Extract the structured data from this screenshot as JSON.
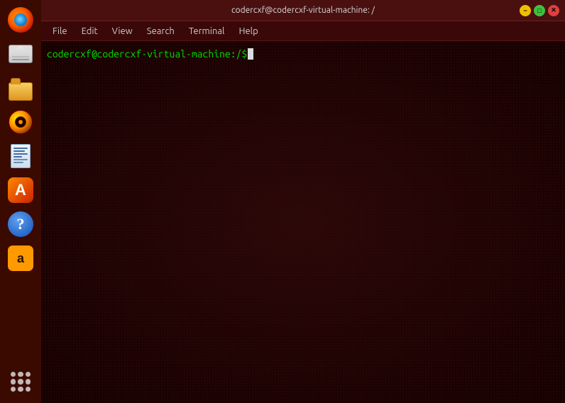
{
  "window": {
    "title": "codercxf@codercxf-virtual-machine: /",
    "controls": {
      "minimize": "−",
      "maximize": "□",
      "close": "✕"
    }
  },
  "menubar": {
    "items": [
      {
        "id": "file",
        "label": "File"
      },
      {
        "id": "edit",
        "label": "Edit"
      },
      {
        "id": "view",
        "label": "View"
      },
      {
        "id": "search",
        "label": "Search"
      },
      {
        "id": "terminal",
        "label": "Terminal"
      },
      {
        "id": "help",
        "label": "Help"
      }
    ]
  },
  "terminal": {
    "prompt": "codercxf@codercxf-virtual-machine:/$ "
  },
  "sidebar": {
    "items": [
      {
        "id": "firefox",
        "label": "Firefox"
      },
      {
        "id": "email",
        "label": "Email"
      },
      {
        "id": "files",
        "label": "Files"
      },
      {
        "id": "music",
        "label": "Music"
      },
      {
        "id": "writer",
        "label": "Writer"
      },
      {
        "id": "appstore",
        "label": "App Store"
      },
      {
        "id": "help",
        "label": "Help"
      },
      {
        "id": "amazon",
        "label": "Amazon"
      },
      {
        "id": "apps",
        "label": "Applications"
      }
    ]
  }
}
